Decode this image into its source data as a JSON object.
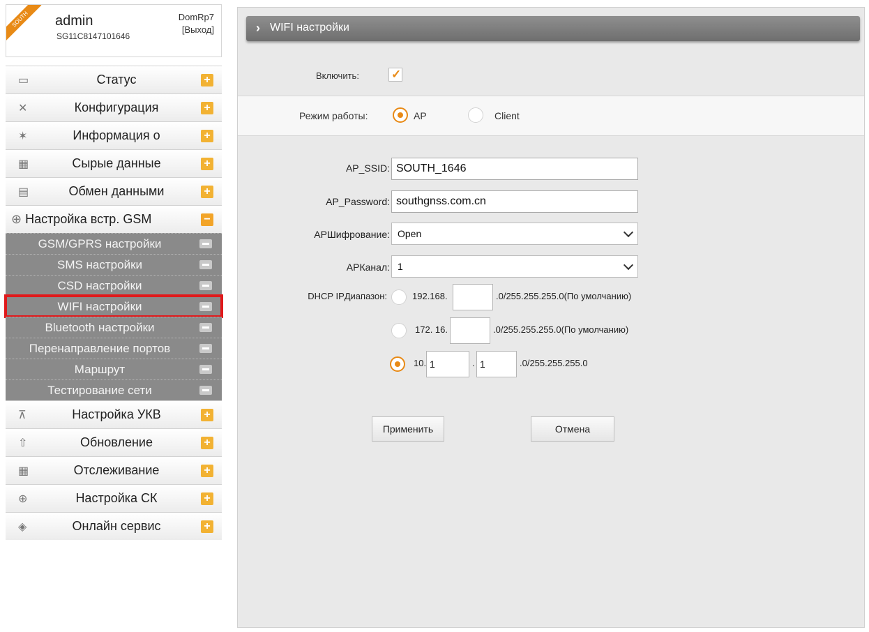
{
  "sidebar": {
    "logo_text": "SOUTH",
    "user": "admin",
    "serial": "SG11C8147101646",
    "device": "DomRp7",
    "logout": "[Выход]",
    "menu_top": [
      {
        "label": "Статус",
        "icon": "monitor-icon"
      },
      {
        "label": "Конфигурация",
        "icon": "tools-icon"
      },
      {
        "label": "Информация о",
        "icon": "satellite-icon"
      },
      {
        "label": "Сырые данные",
        "icon": "calendar-icon"
      },
      {
        "label": "Обмен данными",
        "icon": "network-icon"
      }
    ],
    "open_section": {
      "label": "Настройка встр. GSM",
      "icon": "globe-icon"
    },
    "sub_items": [
      "GSM/GPRS настройки",
      "SMS настройки",
      "CSD настройки",
      "WIFI настройки",
      "Bluetooth настройки",
      "Перенаправление портов",
      "Маршрут",
      "Тестирование сети"
    ],
    "menu_bottom": [
      {
        "label": "Настройка УКВ",
        "icon": "antenna-icon"
      },
      {
        "label": "Обновление",
        "icon": "upload-icon"
      },
      {
        "label": "Отслеживание",
        "icon": "calendar-icon"
      },
      {
        "label": "Настройка СК",
        "icon": "globe-icon"
      },
      {
        "label": "Онлайн сервис",
        "icon": "cube-icon"
      }
    ],
    "expand_symbol": "+",
    "collapse_symbol": "−"
  },
  "main": {
    "title": "WIFI настройки",
    "enable_label": "Включить:",
    "enable_checked": true,
    "mode_label": "Режим работы:",
    "mode_options": [
      "AP",
      "Client"
    ],
    "mode_selected": "AP",
    "ssid_label": "AP_SSID:",
    "ssid_value": "SOUTH_1646",
    "password_label": "AP_Password:",
    "password_value": "southgnss.com.cn",
    "encryption_label": "APШифрование:",
    "encryption_value": "Open",
    "channel_label": "APКанал:",
    "channel_value": "1",
    "dhcp_label": "DHCP IPДиапазон:",
    "dhcp_options": [
      {
        "prefix": "192.168.",
        "suffix": ".0/255.255.255.0(По умолчанию)"
      },
      {
        "prefix": "172. 16.",
        "suffix": ".0/255.255.255.0(По умолчанию)"
      },
      {
        "prefix": "10.",
        "octet1": "1",
        "sep": ".",
        "octet2": "1",
        "suffix": ".0/255.255.255.0"
      }
    ],
    "dhcp_selected": 2,
    "apply_label": "Применить",
    "cancel_label": "Отмена"
  }
}
